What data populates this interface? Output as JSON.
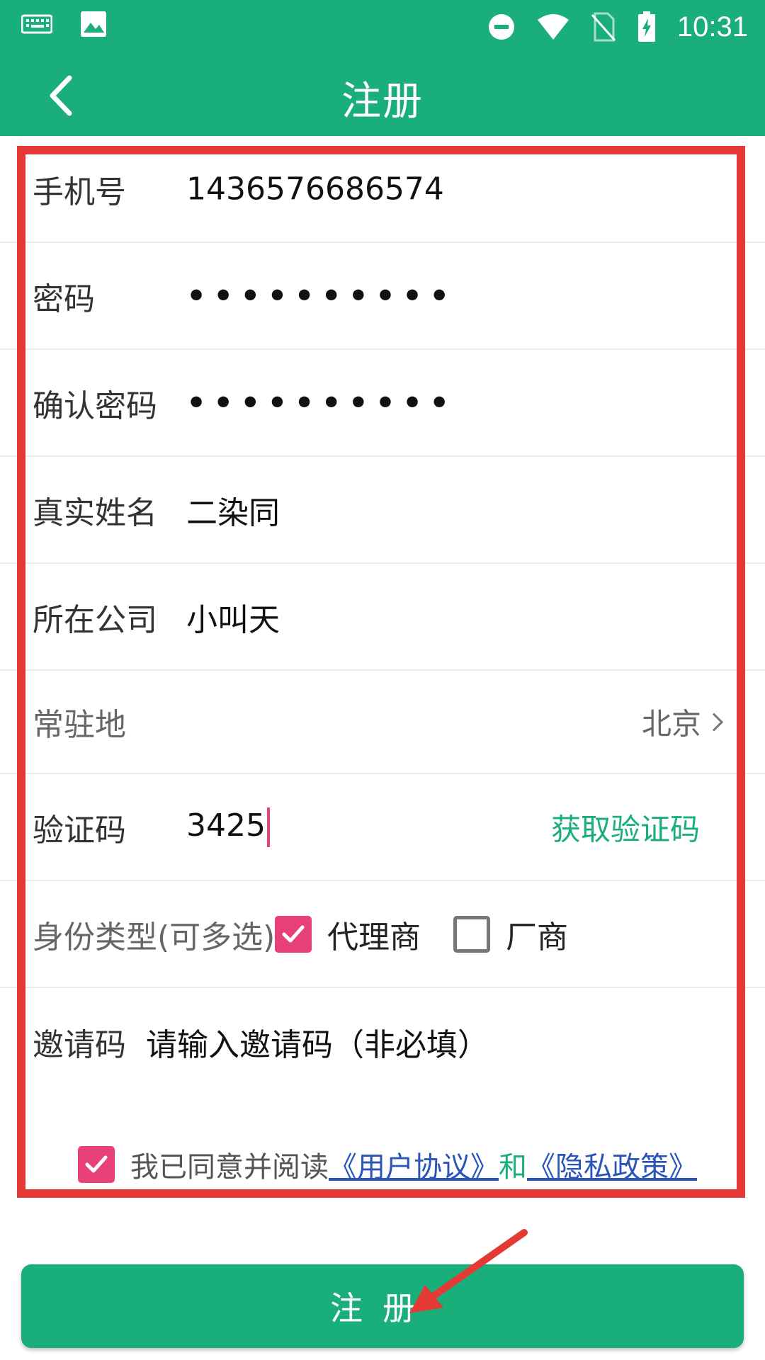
{
  "status_bar": {
    "time": "10:31",
    "icons": [
      "keyboard-icon",
      "image-icon",
      "dnd-icon",
      "wifi-icon",
      "no-sim-icon",
      "battery-charging-icon"
    ]
  },
  "app_bar": {
    "title": "注册",
    "back_icon": "chevron-left-icon"
  },
  "form": {
    "phone": {
      "label": "手机号",
      "value": "1436576686574"
    },
    "password": {
      "label": "密码",
      "value": "••••••••••"
    },
    "confirm_password": {
      "label": "确认密码",
      "value": "••••••••••"
    },
    "real_name": {
      "label": "真实姓名",
      "value": "二染同"
    },
    "company": {
      "label": "所在公司",
      "value": "小叫天"
    },
    "location": {
      "label": "常驻地",
      "value": "北京"
    },
    "verification": {
      "label": "验证码",
      "value": "3425",
      "get_code": "获取验证码"
    },
    "identity": {
      "label": "身份类型(可多选)",
      "options": [
        {
          "label": "代理商",
          "checked": true
        },
        {
          "label": "厂商",
          "checked": false
        }
      ]
    },
    "invite": {
      "label": "邀请码",
      "placeholder": "请输入邀请码（非必填）"
    }
  },
  "agreement": {
    "checked": true,
    "prefix": "我已同意并阅读",
    "user_agreement": "《用户协议》",
    "and": "和",
    "privacy_policy": "《隐私政策》"
  },
  "submit": {
    "label": "注册"
  },
  "colors": {
    "primary": "#1aae7a",
    "accent": "#e8407a",
    "link": "#2a54b8",
    "highlight": "#e53935"
  }
}
